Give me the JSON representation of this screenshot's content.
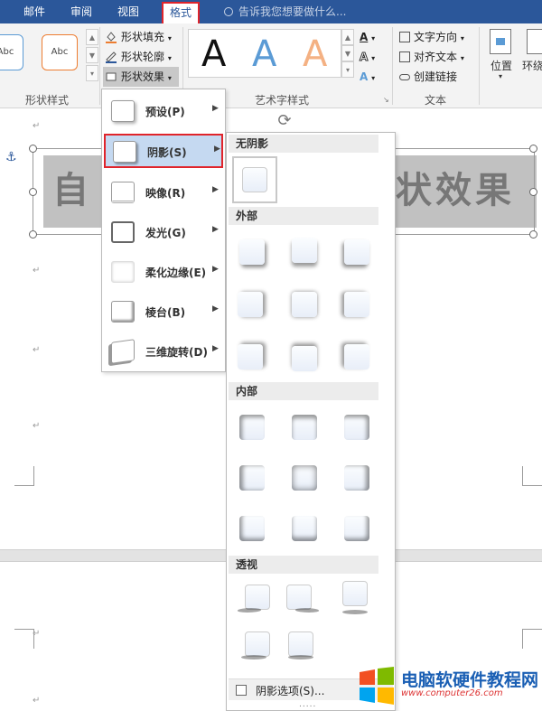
{
  "tabs": [
    {
      "label": "邮件"
    },
    {
      "label": "审阅"
    },
    {
      "label": "视图"
    },
    {
      "label": "格式"
    }
  ],
  "tell_me": {
    "placeholder": "告诉我您想要做什么..."
  },
  "ribbon": {
    "shape_styles": {
      "label": "形状样式",
      "thumbs": [
        "Abc",
        "Abc"
      ]
    },
    "cmds": {
      "fill": "形状填充",
      "outline": "形状轮廓",
      "effects": "形状效果"
    },
    "wordart": {
      "label": "艺术字样式",
      "samples": [
        "A",
        "A",
        "A"
      ]
    },
    "text": {
      "label": "文本",
      "direction": "文字方向",
      "align": "对齐文本",
      "link": "创建链接"
    },
    "position": "位置",
    "wrap": "环绕"
  },
  "doc": {
    "shape_text_left": "自",
    "shape_text_right": "状效果"
  },
  "effects_menu": {
    "items": [
      {
        "label": "预设(P)"
      },
      {
        "label": "阴影(S)"
      },
      {
        "label": "映像(R)"
      },
      {
        "label": "发光(G)"
      },
      {
        "label": "柔化边缘(E)"
      },
      {
        "label": "棱台(B)"
      },
      {
        "label": "三维旋转(D)"
      }
    ]
  },
  "shadow_gallery": {
    "sections": {
      "none": "无阴影",
      "outer": "外部",
      "inner": "内部",
      "perspective": "透视"
    },
    "footer": "阴影选项(S)...",
    "dots": "....."
  },
  "watermark": {
    "title": "电脑软硬件教程网",
    "url": "www.computer26.com"
  },
  "colors": {
    "accent": "#2b579a",
    "highlight": "#e0242b",
    "selected": "#c5d9f1"
  }
}
